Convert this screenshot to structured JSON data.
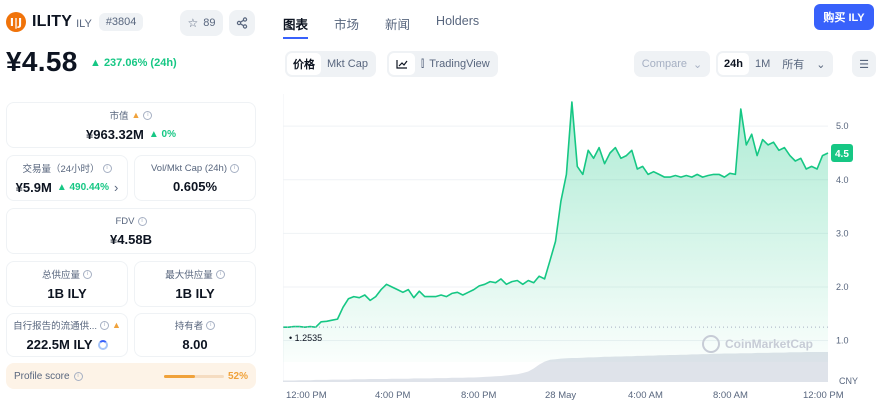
{
  "coin": {
    "name": "ILITY",
    "symbol": "ILY",
    "rank": "#3804",
    "logo_text": "I|J",
    "watch_count": "89"
  },
  "price": {
    "value": "¥4.58",
    "change": "▲ 237.06% (24h)"
  },
  "stats": {
    "market_cap": {
      "label": "市值",
      "value": "¥963.32M",
      "change": "▲ 0%"
    },
    "volume": {
      "label": "交易量（24小时）",
      "value": "¥5.9M",
      "change": "▲ 490.44%"
    },
    "vol_mkt": {
      "label": "Vol/Mkt Cap (24h)",
      "value": "0.605%"
    },
    "fdv": {
      "label": "FDV",
      "value": "¥4.58B"
    },
    "total_supply": {
      "label": "总供应量",
      "value": "1B ILY"
    },
    "max_supply": {
      "label": "最大供应量",
      "value": "1B ILY"
    },
    "circ_supply": {
      "label": "自行报告的流通供...",
      "value": "222.5M ILY"
    },
    "holders": {
      "label": "持有者",
      "value": "8.00"
    }
  },
  "profile": {
    "label": "Profile score",
    "value": "52%",
    "fraction": 0.52
  },
  "tabs": [
    "图表",
    "市场",
    "新闻",
    "Holders"
  ],
  "buy_label": "购买 ILY",
  "toolbar": {
    "price": "价格",
    "mktcap": "Mkt Cap",
    "tradingview": "TradingView",
    "compare": "Compare",
    "ranges": [
      "24h",
      "1M",
      "所有"
    ]
  },
  "chart_data": {
    "type": "area",
    "start_label": "1.2535",
    "current_label": "4.5",
    "y_ticks": [
      1.0,
      2.0,
      3.0,
      4.0,
      5.0
    ],
    "ylim": [
      0.6,
      5.6
    ],
    "x_ticks": [
      "12:00 PM",
      "4:00 PM",
      "8:00 PM",
      "28 May",
      "4:00 AM",
      "8:00 AM",
      "12:00 PM"
    ],
    "unit": "CNY",
    "watermark": "CoinMarketCap",
    "x": [
      0,
      1,
      2,
      3,
      4,
      5,
      6,
      7,
      8,
      9,
      10,
      11,
      12,
      13,
      14,
      15,
      16,
      17,
      18,
      19,
      20,
      21,
      22,
      23,
      24,
      25,
      26,
      27,
      28,
      29,
      30,
      31,
      32,
      33,
      34,
      35,
      36,
      37,
      38,
      39,
      40,
      41,
      42,
      43,
      44,
      45,
      46,
      47,
      48,
      49,
      50,
      51,
      52,
      53,
      54,
      55,
      56,
      57,
      58,
      59,
      60,
      61,
      62,
      63,
      64,
      65,
      66,
      67,
      68,
      69,
      70,
      71,
      72,
      73,
      74,
      75,
      76,
      77,
      78,
      79,
      80,
      81,
      82,
      83,
      84,
      85,
      86,
      87,
      88,
      89,
      90,
      91,
      92,
      93,
      94,
      95,
      96,
      97,
      98,
      99,
      100
    ],
    "y": [
      1.25,
      1.25,
      1.26,
      1.26,
      1.25,
      1.26,
      1.25,
      1.35,
      1.36,
      1.38,
      1.4,
      1.62,
      1.78,
      1.82,
      1.8,
      1.85,
      1.75,
      1.82,
      1.95,
      2.05,
      2.0,
      1.95,
      1.9,
      1.95,
      1.8,
      1.92,
      1.82,
      1.82,
      1.82,
      1.85,
      1.82,
      1.88,
      1.9,
      1.85,
      1.9,
      1.95,
      2.02,
      2.05,
      2.1,
      2.08,
      2.15,
      2.05,
      2.1,
      2.12,
      2.05,
      2.12,
      2.08,
      2.2,
      2.15,
      2.5,
      2.85,
      3.6,
      4.1,
      5.45,
      4.25,
      4.1,
      4.55,
      4.4,
      4.6,
      4.3,
      4.5,
      4.6,
      4.4,
      4.45,
      4.55,
      4.2,
      4.25,
      4.1,
      4.15,
      4.1,
      4.05,
      4.05,
      4.08,
      4.05,
      4.08,
      4.05,
      4.1,
      4.05,
      4.08,
      4.1,
      4.1,
      4.05,
      4.12,
      4.1,
      5.32,
      4.65,
      4.85,
      4.45,
      4.75,
      4.65,
      4.7,
      4.55,
      4.6,
      4.45,
      4.35,
      4.4,
      4.2,
      4.25,
      4.2,
      4.45,
      4.5
    ],
    "volume": [
      0.05,
      0.05,
      0.05,
      0.06,
      0.06,
      0.06,
      0.07,
      0.07,
      0.07,
      0.08,
      0.08,
      0.08,
      0.08,
      0.09,
      0.09,
      0.09,
      0.1,
      0.1,
      0.1,
      0.1,
      0.11,
      0.11,
      0.11,
      0.11,
      0.12,
      0.12,
      0.12,
      0.12,
      0.13,
      0.13,
      0.13,
      0.14,
      0.14,
      0.14,
      0.15,
      0.15,
      0.16,
      0.17,
      0.18,
      0.19,
      0.2,
      0.22,
      0.24,
      0.26,
      0.3,
      0.35,
      0.45,
      0.58,
      0.68,
      0.74,
      0.76,
      0.78,
      0.79,
      0.8,
      0.8,
      0.81,
      0.82,
      0.82,
      0.83,
      0.84,
      0.84,
      0.85,
      0.85,
      0.86,
      0.86,
      0.87,
      0.87,
      0.88,
      0.88,
      0.89,
      0.89,
      0.9,
      0.9,
      0.91,
      0.91,
      0.92,
      0.92,
      0.93,
      0.93,
      0.94,
      0.94,
      0.95,
      0.95,
      0.95,
      0.96,
      0.96,
      0.96,
      0.97,
      0.97,
      0.97,
      0.98,
      0.98,
      0.98,
      0.99,
      0.99,
      0.99,
      1.0,
      1.0,
      1.0,
      1.0,
      1.0
    ],
    "colors": {
      "line": "#16c784",
      "fill": "#16c784",
      "grid": "#eff2f5",
      "axis_text": "#58667e"
    }
  }
}
